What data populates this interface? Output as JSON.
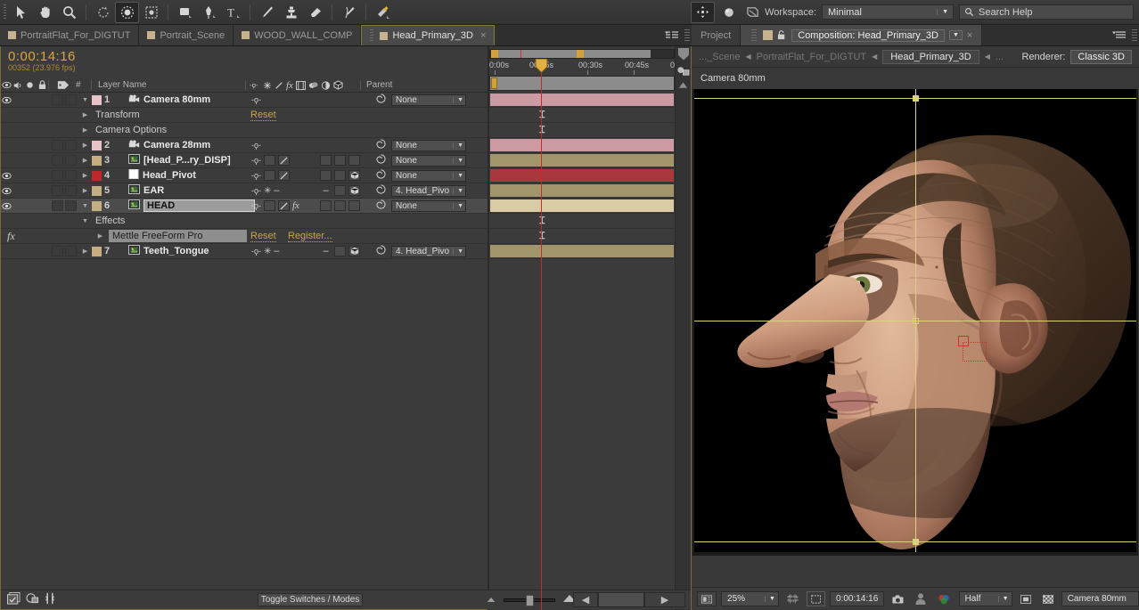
{
  "app": {
    "name": "Adobe After Effects"
  },
  "toolbar": {
    "tools": [
      {
        "name": "selection-tool",
        "glyph": "arrow",
        "active": false
      },
      {
        "name": "hand-tool",
        "glyph": "hand",
        "active": false
      },
      {
        "name": "zoom-tool",
        "glyph": "magnifier",
        "active": false
      },
      {
        "name": "rotation-tool",
        "glyph": "rotate",
        "active": false
      },
      {
        "name": "orbit-camera-tool",
        "glyph": "orbit",
        "active": true
      },
      {
        "name": "track-xy-camera-tool",
        "glyph": "track-xy",
        "active": false
      },
      {
        "name": "shape-tool",
        "glyph": "rect",
        "active": false
      },
      {
        "name": "pen-tool",
        "glyph": "pen",
        "active": false
      },
      {
        "name": "type-tool",
        "glyph": "type",
        "active": false
      },
      {
        "name": "brush-tool",
        "glyph": "brush",
        "active": false
      },
      {
        "name": "clone-stamp-tool",
        "glyph": "stamp",
        "active": false
      },
      {
        "name": "eraser-tool",
        "glyph": "eraser",
        "active": false
      },
      {
        "name": "roto-brush-tool",
        "glyph": "roto",
        "active": false
      },
      {
        "name": "puppet-pin-tool",
        "glyph": "pin",
        "active": false
      },
      {
        "name": "local-axis-mode",
        "glyph": "axis",
        "active": true
      },
      {
        "name": "world-axis-mode",
        "glyph": "sphere",
        "active": false
      },
      {
        "name": "view-axis-mode",
        "glyph": "viewaxis",
        "active": false
      }
    ],
    "workspace_label": "Workspace:",
    "workspace_value": "Minimal",
    "search_help_placeholder": "Search Help"
  },
  "tabs": [
    {
      "label": "PortraitFlat_For_DIGTUT",
      "selected": false,
      "closeable": false
    },
    {
      "label": "Portrait_Scene",
      "selected": false,
      "closeable": false
    },
    {
      "label": "WOOD_WALL_COMP",
      "selected": false,
      "closeable": false
    },
    {
      "label": "Head_Primary_3D",
      "selected": true,
      "closeable": true
    }
  ],
  "timeline": {
    "current_time": "0:00:14:16",
    "frame_info": "00352 (23.976 fps)",
    "search_placeholder": "",
    "columns": {
      "hash": "#",
      "layer_name": "Layer Name",
      "parent": "Parent",
      "switches": "-ф- ✺ ╲ fx ▦ ◐ ◑ ⬡"
    },
    "ruler_labels": [
      "0:00s",
      "00:15s",
      "00:30s",
      "00:45s",
      "0"
    ],
    "toggle_switches_label": "Toggle Switches / Modes",
    "layers": [
      {
        "index": "1",
        "name": "Camera 80mm",
        "type": "camera",
        "color": "#e7c2c6",
        "visible": true,
        "selected": false,
        "expanded": true,
        "parent": "None",
        "bar_color": "#cb9aa3",
        "has_properties": true
      },
      {
        "index": "2",
        "name": "Camera 28mm",
        "type": "camera",
        "color": "#e7c2c6",
        "visible": false,
        "selected": false,
        "expanded": false,
        "parent": "None",
        "bar_color": "#cb9aa3"
      },
      {
        "index": "3",
        "name": "[Head_P...ry_DISP]",
        "type": "footage",
        "color": "#c6ae83",
        "visible": false,
        "selected": false,
        "expanded": false,
        "parent": "None",
        "bar_color": "#a2946b"
      },
      {
        "index": "4",
        "name": "Head_Pivot",
        "type": "solid",
        "color": "#c0292c",
        "visible": true,
        "selected": false,
        "expanded": false,
        "parent": "None",
        "bar_color": "#a8383b"
      },
      {
        "index": "5",
        "name": "EAR",
        "type": "footage",
        "color": "#c6ae83",
        "visible": true,
        "selected": false,
        "expanded": false,
        "parent": "4. Head_Pivo",
        "bar_color": "#a2946b"
      },
      {
        "index": "6",
        "name": "HEAD",
        "type": "footage",
        "color": "#c6ae83",
        "visible": true,
        "selected": true,
        "expanded": true,
        "parent": "None",
        "bar_color": "#d8cba6"
      },
      {
        "index": "7",
        "name": "Teeth_Tongue",
        "type": "footage",
        "color": "#c6ae83",
        "visible": false,
        "selected": false,
        "expanded": false,
        "parent": "4. Head_Pivo",
        "bar_color": "#a2946b"
      }
    ],
    "camera_properties": [
      {
        "label": "Transform",
        "action": "Reset"
      },
      {
        "label": "Camera Options",
        "action": ""
      }
    ],
    "head_effects": {
      "group_label": "Effects",
      "effect_name": "Mettle FreeForm Pro",
      "reset_label": "Reset",
      "register_label": "Register..."
    }
  },
  "composition": {
    "project_tab": "Project",
    "comp_tab": "Composition: Head_Primary_3D",
    "breadcrumbs": [
      {
        "label": "..._Scene",
        "current": false
      },
      {
        "label": "PortraitFlat_For_DIGTUT",
        "current": false
      },
      {
        "label": "Head_Primary_3D",
        "current": true
      },
      {
        "label": "...",
        "current": false
      }
    ],
    "renderer_label": "Renderer:",
    "renderer_value": "Classic 3D",
    "active_camera_label": "Camera 80mm",
    "footer": {
      "zoom": "25%",
      "time": "0:00:14:16",
      "resolution": "Half",
      "view_camera": "Camera 80mm"
    }
  }
}
